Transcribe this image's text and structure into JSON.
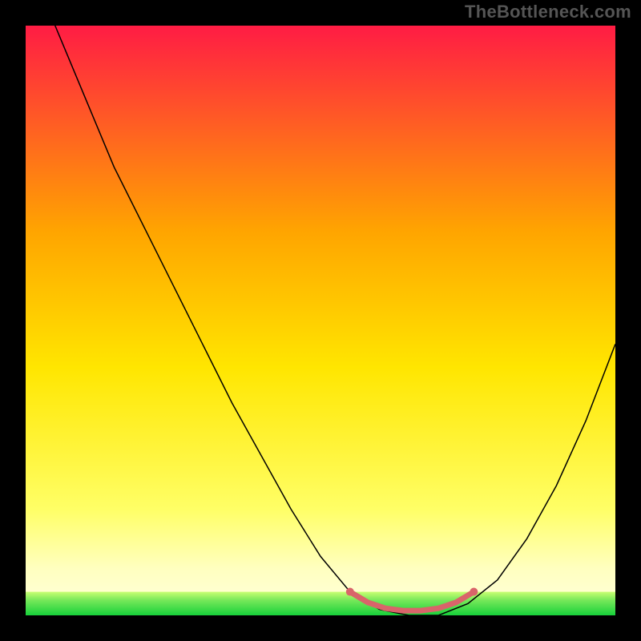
{
  "attribution": "TheBottleneck.com",
  "chart_data": {
    "type": "line",
    "title": "",
    "xlabel": "",
    "ylabel": "",
    "xlim": [
      0,
      100
    ],
    "ylim": [
      0,
      100
    ],
    "grid": false,
    "legend": false,
    "gradient_colors": {
      "top": "#ff1c44",
      "upper_mid": "#ffa500",
      "mid": "#ffe600",
      "lower": "#ffff66",
      "bottom": "#17d13a"
    },
    "series": [
      {
        "name": "bottleneck-curve",
        "color": "#000000",
        "width": 1.5,
        "x": [
          0,
          5,
          10,
          15,
          20,
          25,
          30,
          35,
          40,
          45,
          50,
          55,
          60,
          65,
          70,
          75,
          80,
          85,
          90,
          95,
          100
        ],
        "y": [
          120,
          100,
          88,
          76,
          66,
          56,
          46,
          36,
          27,
          18,
          10,
          4,
          1,
          0,
          0,
          2,
          6,
          13,
          22,
          33,
          46
        ]
      },
      {
        "name": "optimal-band",
        "color": "#d9646a",
        "width": 7,
        "x": [
          55,
          58,
          61,
          64,
          67,
          70,
          73,
          76
        ],
        "y": [
          4.0,
          2.2,
          1.2,
          0.8,
          0.8,
          1.2,
          2.2,
          4.0
        ]
      }
    ],
    "green_band": {
      "y_from": 0,
      "y_to": 4
    }
  }
}
